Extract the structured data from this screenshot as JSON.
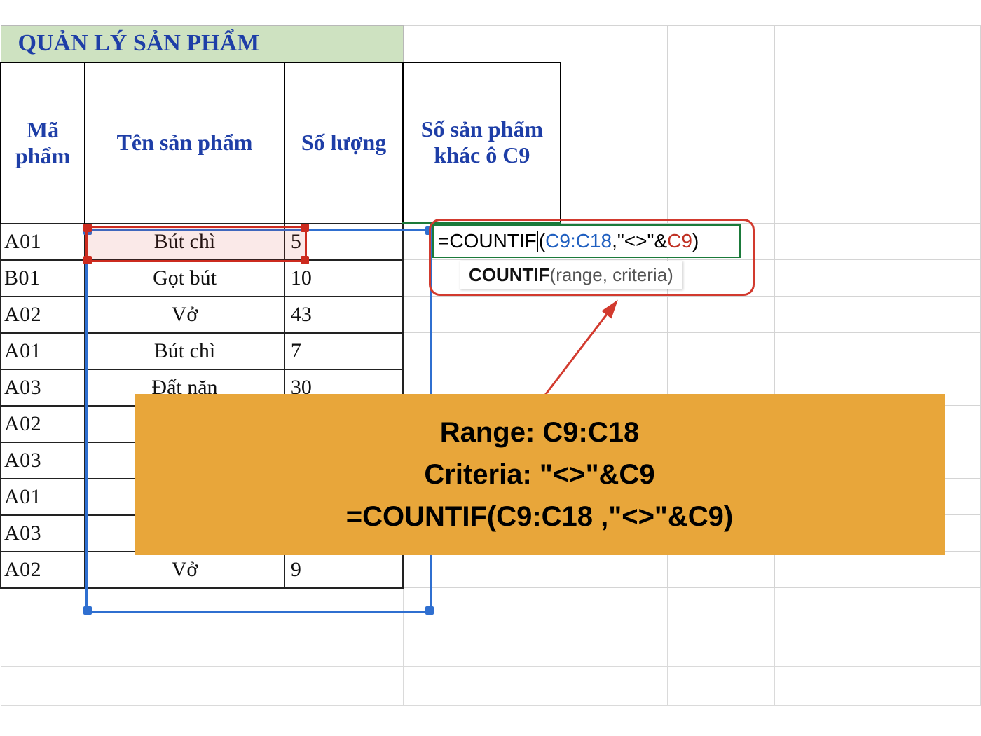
{
  "title": "QUẢN LÝ SẢN PHẨM",
  "headers": {
    "ma": "Mã\nphẩm",
    "ten": "Tên sản phẩm",
    "soluong": "Số lượng",
    "khac": "Số sản phẩm khác ô C9"
  },
  "rows": [
    {
      "ma": "A01",
      "ten": "Bút chì",
      "qty": "5"
    },
    {
      "ma": "B01",
      "ten": "Gọt bút",
      "qty": "10"
    },
    {
      "ma": "A02",
      "ten": "Vở",
      "qty": "43"
    },
    {
      "ma": "A01",
      "ten": "Bút chì",
      "qty": "7"
    },
    {
      "ma": "A03",
      "ten": "Đất nặn",
      "qty": "30"
    },
    {
      "ma": "A02",
      "ten": "",
      "qty": ""
    },
    {
      "ma": "A03",
      "ten": "",
      "qty": ""
    },
    {
      "ma": "A01",
      "ten": "",
      "qty": ""
    },
    {
      "ma": "A03",
      "ten": "",
      "qty": ""
    },
    {
      "ma": "A02",
      "ten": "Vở",
      "qty": "9"
    }
  ],
  "formula": {
    "eq": "=",
    "fn": "COUNTIF",
    "open": "(",
    "ref1": "C9:C18",
    "comma": ",",
    "quote_open": "\"",
    "op": "<>",
    "quote_close": "\"",
    "amp": "&",
    "ref2": "C9",
    "close": ")"
  },
  "tooltip": {
    "fn": "COUNTIF",
    "args": "(range, criteria)"
  },
  "panel": {
    "line1": "Range: C9:C18",
    "line2": "Criteria: \"<>\"&C9",
    "line3": "=COUNTIF(C9:C18 ,\"<>\"&C9)"
  }
}
